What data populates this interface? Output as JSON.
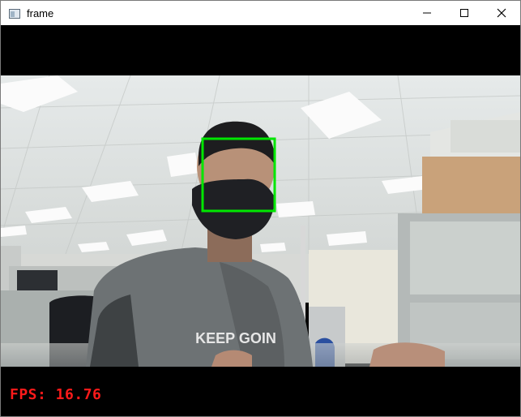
{
  "window": {
    "title": "frame",
    "icon": "window-app-icon",
    "controls": [
      "minimize-icon",
      "maximize-icon",
      "close-icon"
    ]
  },
  "overlay": {
    "fps_text": "FPS: 16.76",
    "fps_color": "#ff1a1a",
    "face_box_color": "#00e600"
  },
  "scene": {
    "shirt_text": "KEEP GOIN"
  }
}
